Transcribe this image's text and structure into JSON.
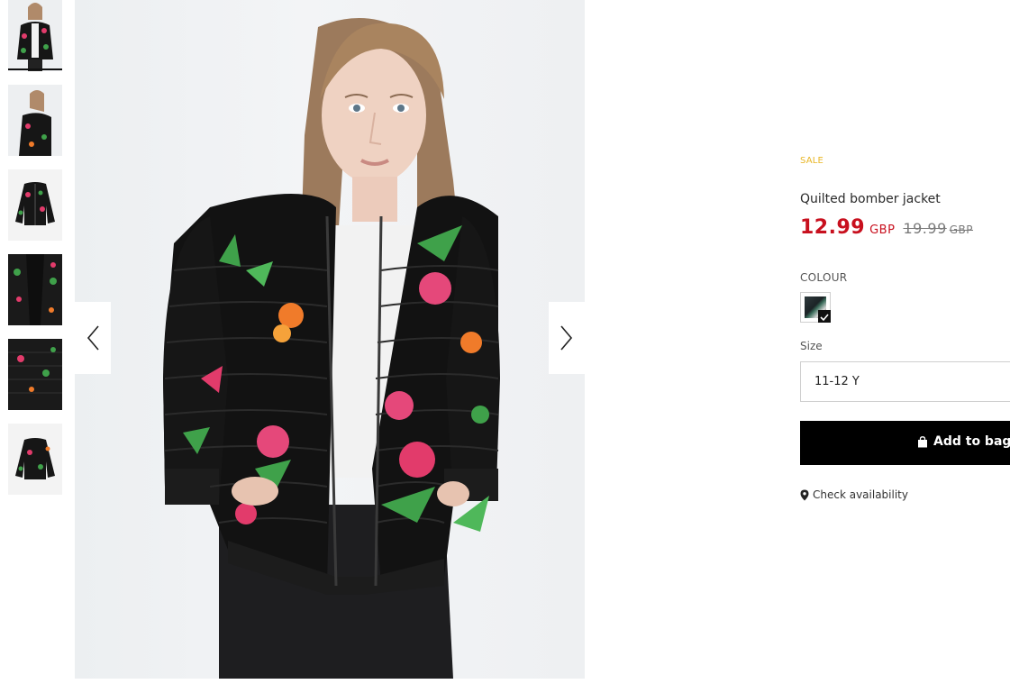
{
  "gallery": {
    "thumbnails": [
      {
        "alt": "Front view"
      },
      {
        "alt": "Side view"
      },
      {
        "alt": "Flat front"
      },
      {
        "alt": "Lining detail"
      },
      {
        "alt": "Cuff detail"
      },
      {
        "alt": "Flat back"
      }
    ],
    "active_index": 0,
    "prev_icon": "chevron-left-icon",
    "next_icon": "chevron-right-icon"
  },
  "product": {
    "badge": "SALE",
    "title": "Quilted bomber jacket",
    "price_new": "12.99",
    "price_new_currency": "GBP",
    "price_old": "19.99",
    "price_old_currency": "GBP",
    "colour_label": "COLOUR",
    "size_label": "Size",
    "size_value": "11-12 Y",
    "add_to_bag": "Add to bag",
    "check_availability": "Check availability"
  },
  "colors": {
    "sale": "#e8b626",
    "price": "#c8101e",
    "button": "#000000"
  }
}
